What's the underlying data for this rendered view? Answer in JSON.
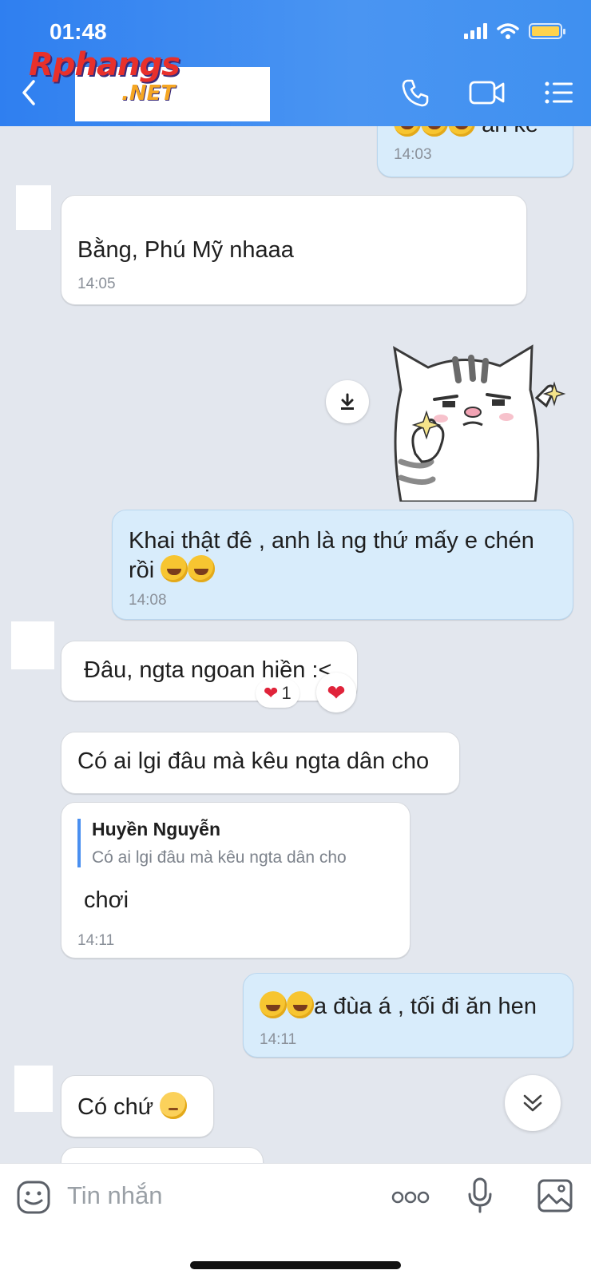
{
  "status": {
    "time": "01:48"
  },
  "header": {
    "logo_main": "Rphangs",
    "logo_net": ".NET"
  },
  "messages": {
    "top_partial": {
      "text": "ăn kê",
      "time": "14:03"
    },
    "m1": {
      "text": "Bằng, Phú Mỹ nhaaa",
      "time": "14:05"
    },
    "m2": {
      "text_line1": "Khai thật đê , anh là ng thứ mấy e chén",
      "text_line2": "rồi",
      "time": "14:08"
    },
    "m3": {
      "text": "Đâu, ngta ngoan hiền :<",
      "reaction_count": "1"
    },
    "m4": {
      "text": "Có ai lgi đâu mà kêu ngta dân cho"
    },
    "m5": {
      "quote_author": "Huyền Nguyễn",
      "quote_text": "Có ai lgi đâu mà kêu ngta dân cho",
      "text": "chơi",
      "time": "14:11"
    },
    "m6": {
      "text": "a đùa á , tối đi ăn hen",
      "time": "14:11"
    },
    "m7": {
      "text": "Có chứ"
    }
  },
  "composer": {
    "placeholder": "Tin nhắn"
  },
  "colors": {
    "header": "#2f7ff0",
    "outgoing": "#d8ecfb",
    "incoming": "#ffffff",
    "background": "#e3e7ee"
  },
  "icons": [
    "back-icon",
    "phone-icon",
    "video-icon",
    "menu-icon",
    "download-icon",
    "heart-icon",
    "scroll-down-icon",
    "sticker-icon",
    "more-icon",
    "mic-icon",
    "image-icon"
  ]
}
